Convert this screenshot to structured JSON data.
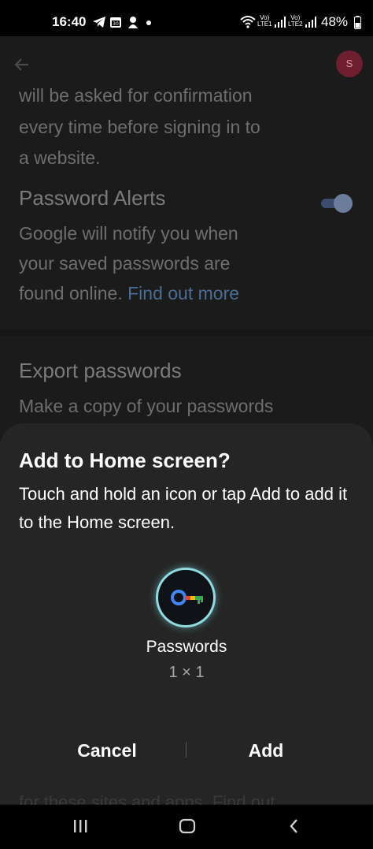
{
  "status_bar": {
    "time": "16:40",
    "lte1": "Vo)\nLTE1",
    "lte2": "Vo)\nLTE2",
    "battery": "48%"
  },
  "app_bar": {
    "avatar_initial": "S"
  },
  "settings": {
    "confirm_text_line1": "will be asked for confirmation",
    "confirm_text_line2": "every time before signing in to",
    "confirm_text_line3": "a website.",
    "alerts_title": "Password Alerts",
    "alerts_desc_line1": "Google will notify you when",
    "alerts_desc_line2": "your saved passwords are",
    "alerts_desc_line3": "found online. ",
    "alerts_link": "Find out more",
    "alerts_enabled": true,
    "export_title": "Export passwords",
    "export_desc": "Make a copy of your passwords"
  },
  "dialog": {
    "title": "Add to Home screen?",
    "message": "Touch and hold an icon or tap Add to add it to the Home screen.",
    "app_name": "Passwords",
    "app_size": "1 × 1",
    "cancel_label": "Cancel",
    "add_label": "Add",
    "peek_text": "for these sites and apps. Find out"
  },
  "colors": {
    "sheet_bg": "#252525",
    "icon_ring": "#8fdbe0",
    "key_blue": "#4285f4",
    "key_red": "#ea4335",
    "key_yellow": "#fbbc04",
    "key_green": "#34a853"
  }
}
